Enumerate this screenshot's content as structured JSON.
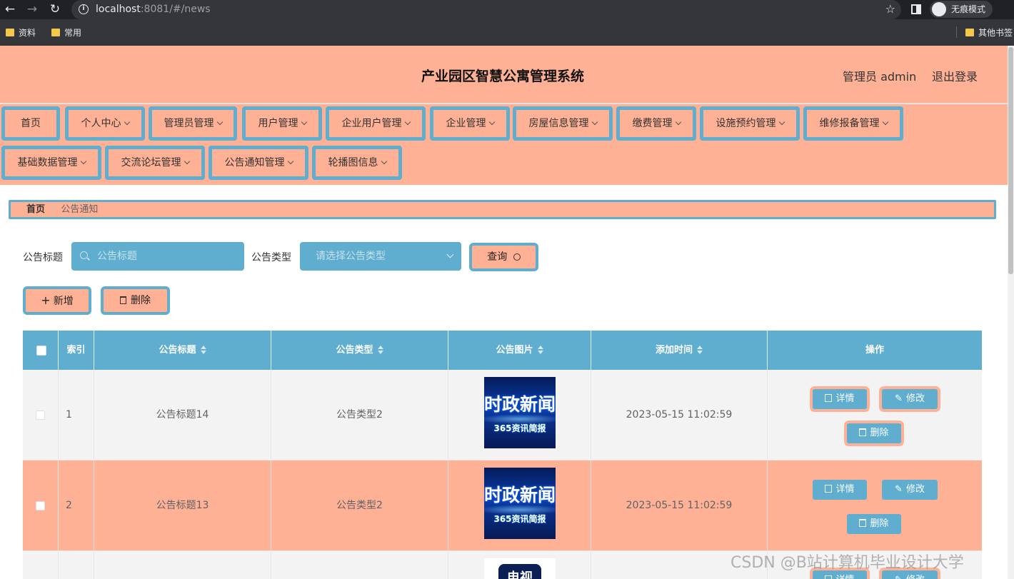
{
  "browser": {
    "url_host": "localhost",
    "url_rest": ":8081/#/news",
    "incognito_label": "无痕模式",
    "bookmarks": [
      "资料",
      "常用"
    ],
    "other_bookmarks": "其他书签"
  },
  "header": {
    "title": "产业园区智慧公寓管理系统",
    "admin_label": "管理员 admin",
    "logout_label": "退出登录"
  },
  "menu": [
    {
      "label": "首页",
      "has_arrow": false
    },
    {
      "label": "个人中心",
      "has_arrow": true
    },
    {
      "label": "管理员管理",
      "has_arrow": true
    },
    {
      "label": "用户管理",
      "has_arrow": true
    },
    {
      "label": "企业用户管理",
      "has_arrow": true
    },
    {
      "label": "企业管理",
      "has_arrow": true
    },
    {
      "label": "房屋信息管理",
      "has_arrow": true
    },
    {
      "label": "缴费管理",
      "has_arrow": true
    },
    {
      "label": "设施预约管理",
      "has_arrow": true
    },
    {
      "label": "维修报备管理",
      "has_arrow": true
    },
    {
      "label": "基础数据管理",
      "has_arrow": true
    },
    {
      "label": "交流论坛管理",
      "has_arrow": true
    },
    {
      "label": "公告通知管理",
      "has_arrow": true
    },
    {
      "label": "轮播图信息",
      "has_arrow": true
    }
  ],
  "breadcrumb": {
    "home": "首页",
    "separator": "/",
    "current": "公告通知"
  },
  "search": {
    "title_label": "公告标题",
    "title_placeholder": "公告标题",
    "type_label": "公告类型",
    "type_placeholder": "请选择公告类型",
    "query_button": "查询"
  },
  "actions": {
    "add_label": "新增",
    "delete_label": "删除"
  },
  "table": {
    "headers": [
      "索引",
      "公告标题",
      "公告类型",
      "公告图片",
      "添加时间",
      "操作"
    ],
    "rows": [
      {
        "index": "1",
        "title": "公告标题14",
        "type": "公告类型2",
        "image_text_1": "时政新闻",
        "image_text_2": "365资讯简报",
        "time": "2023-05-15 11:02:59"
      },
      {
        "index": "2",
        "title": "公告标题13",
        "type": "公告类型2",
        "image_text_1": "时政新闻",
        "image_text_2": "365资讯简报",
        "time": "2023-05-15 11:02:59"
      }
    ],
    "row_partial_image_text": "电视",
    "row_actions": {
      "detail": "详情",
      "edit": "修改",
      "delete": "删除"
    }
  },
  "watermark": "CSDN @B站计算机毕业设计大学",
  "colors": {
    "accent_blue": "#5fadcf",
    "salmon": "#ffb196",
    "row_alt": "#f3f3f3"
  }
}
